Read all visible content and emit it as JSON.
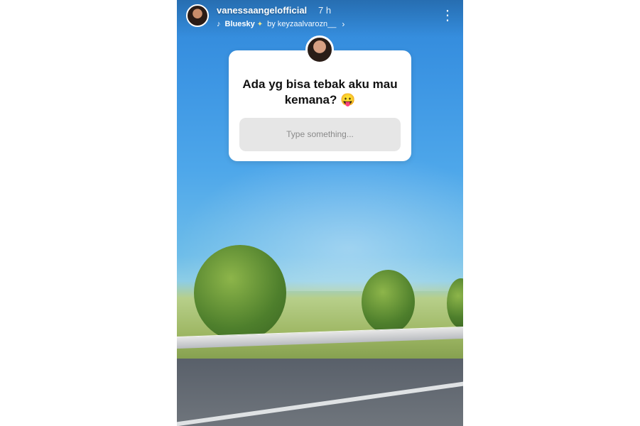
{
  "story": {
    "username": "vanessaangelofficial",
    "time": "7 h",
    "music": {
      "song": "Bluesky",
      "sparkle": "✦",
      "by_label": "by keyzaalvarozn__",
      "chevron": "›",
      "icon": "music-note-icon"
    },
    "more_icon": "⋮"
  },
  "question_box": {
    "question_text": "Ada yg bisa tebak aku mau kemana?",
    "emoji": "😛",
    "input_placeholder": "Type something..."
  },
  "colors": {
    "card_bg": "#ffffff",
    "input_bg": "#e6e6e6",
    "sky": "#3c95e3"
  }
}
